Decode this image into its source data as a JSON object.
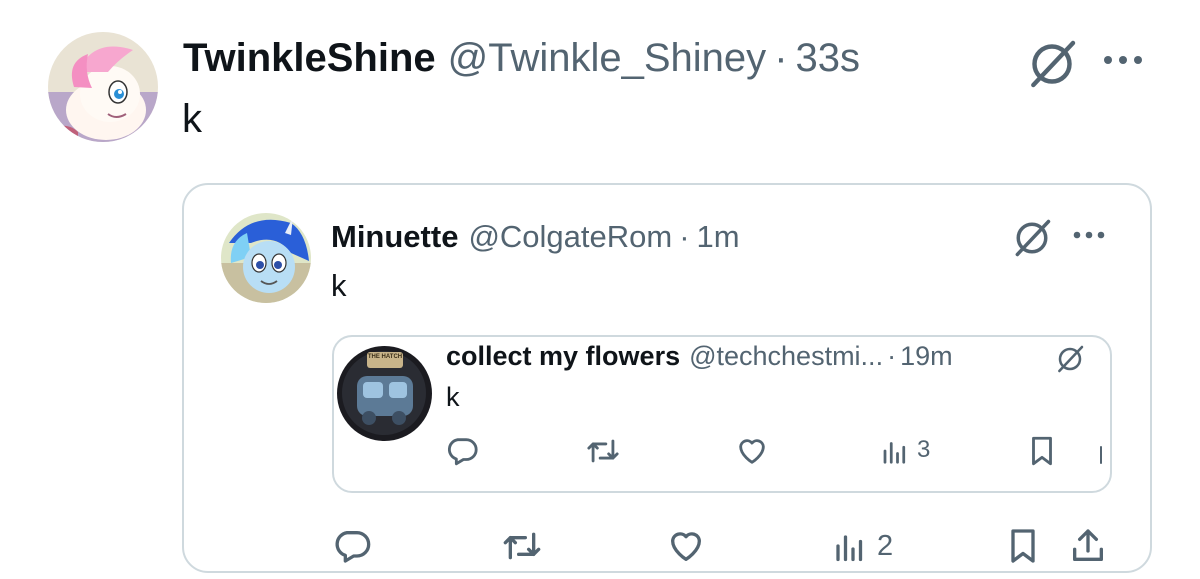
{
  "top_post": {
    "display_name": "TwinkleShine",
    "handle": "@Twinkle_Shiney",
    "separator": "·",
    "time": "33s",
    "text": "k"
  },
  "quote_1": {
    "display_name": "Minuette",
    "handle": "@ColgateRom",
    "separator": "·",
    "time": "1m",
    "text": "k",
    "views": "2"
  },
  "quote_2": {
    "display_name": "collect my flowers",
    "handle": "@techchestmi...",
    "separator": "·",
    "time": "19m",
    "text": "k",
    "views": "3",
    "avatar_badge": "THE HATCH"
  },
  "icons": {
    "grok": "grok-slash-icon",
    "more": "more-dots-icon",
    "reply": "reply-bubble-icon",
    "repost": "repost-arrows-icon",
    "like": "heart-icon",
    "views": "bar-chart-icon",
    "bookmark": "bookmark-icon",
    "share": "share-upload-icon"
  },
  "colors": {
    "text": "#0f1419",
    "muted": "#536471",
    "border": "#cfd9de"
  }
}
